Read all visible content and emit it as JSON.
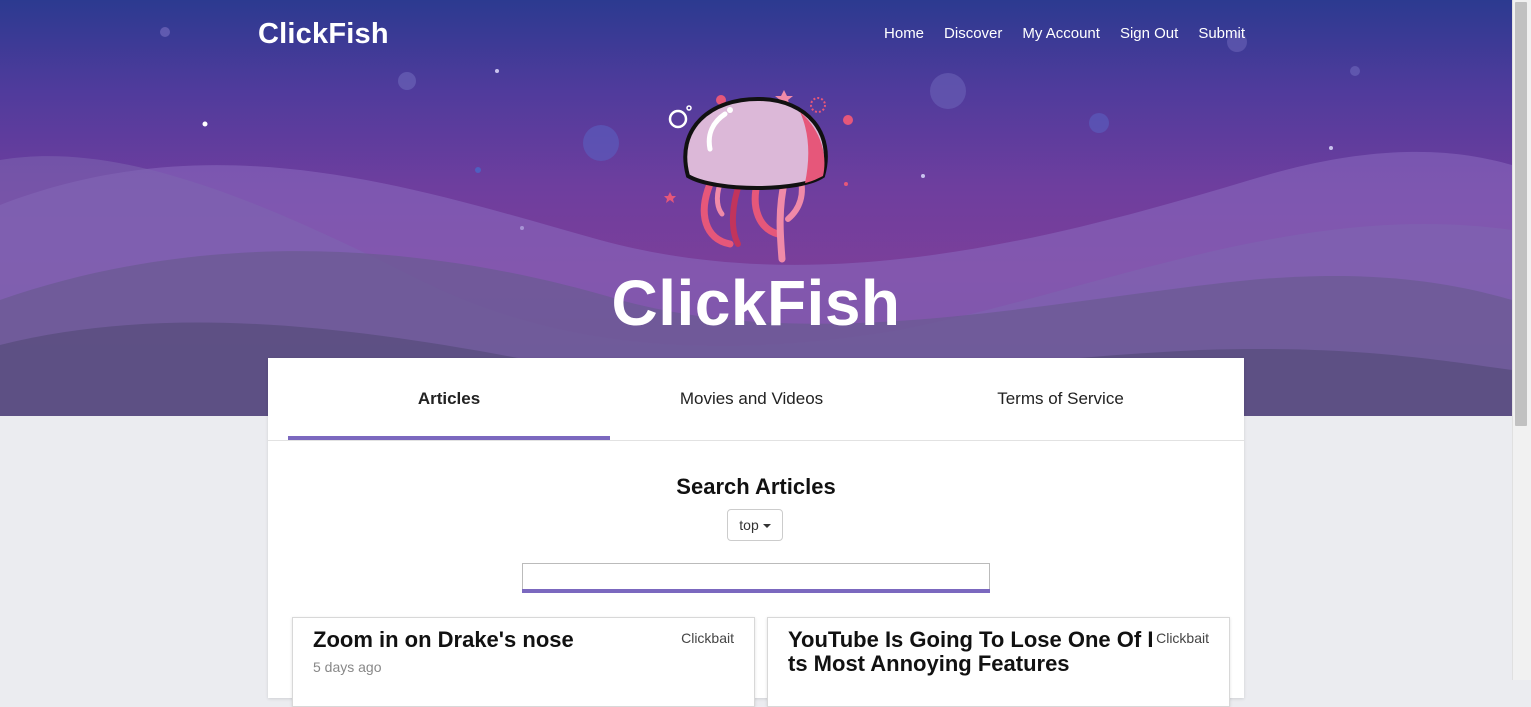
{
  "header": {
    "brand": "ClickFish",
    "nav": [
      "Home",
      "Discover",
      "My Account",
      "Sign Out",
      "Submit"
    ]
  },
  "hero": {
    "title": "ClickFish"
  },
  "tabs": [
    {
      "label": "Articles",
      "active": true
    },
    {
      "label": "Movies and Videos",
      "active": false
    },
    {
      "label": "Terms of Service",
      "active": false
    }
  ],
  "search": {
    "title": "Search Articles",
    "sort_value": "top",
    "input_value": ""
  },
  "articles": [
    {
      "title": "Zoom in on Drake's nose",
      "tag": "Clickbait",
      "time": "5 days ago"
    },
    {
      "title": "YouTube Is Going To Lose One Of Its Most Annoying Features",
      "tag": "Clickbait",
      "time": ""
    }
  ],
  "colors": {
    "accent": "#7b68bf",
    "hero_top": "#2c3a90",
    "hero_mid": "#7b3f9a",
    "page_bg": "#ebecf0"
  }
}
